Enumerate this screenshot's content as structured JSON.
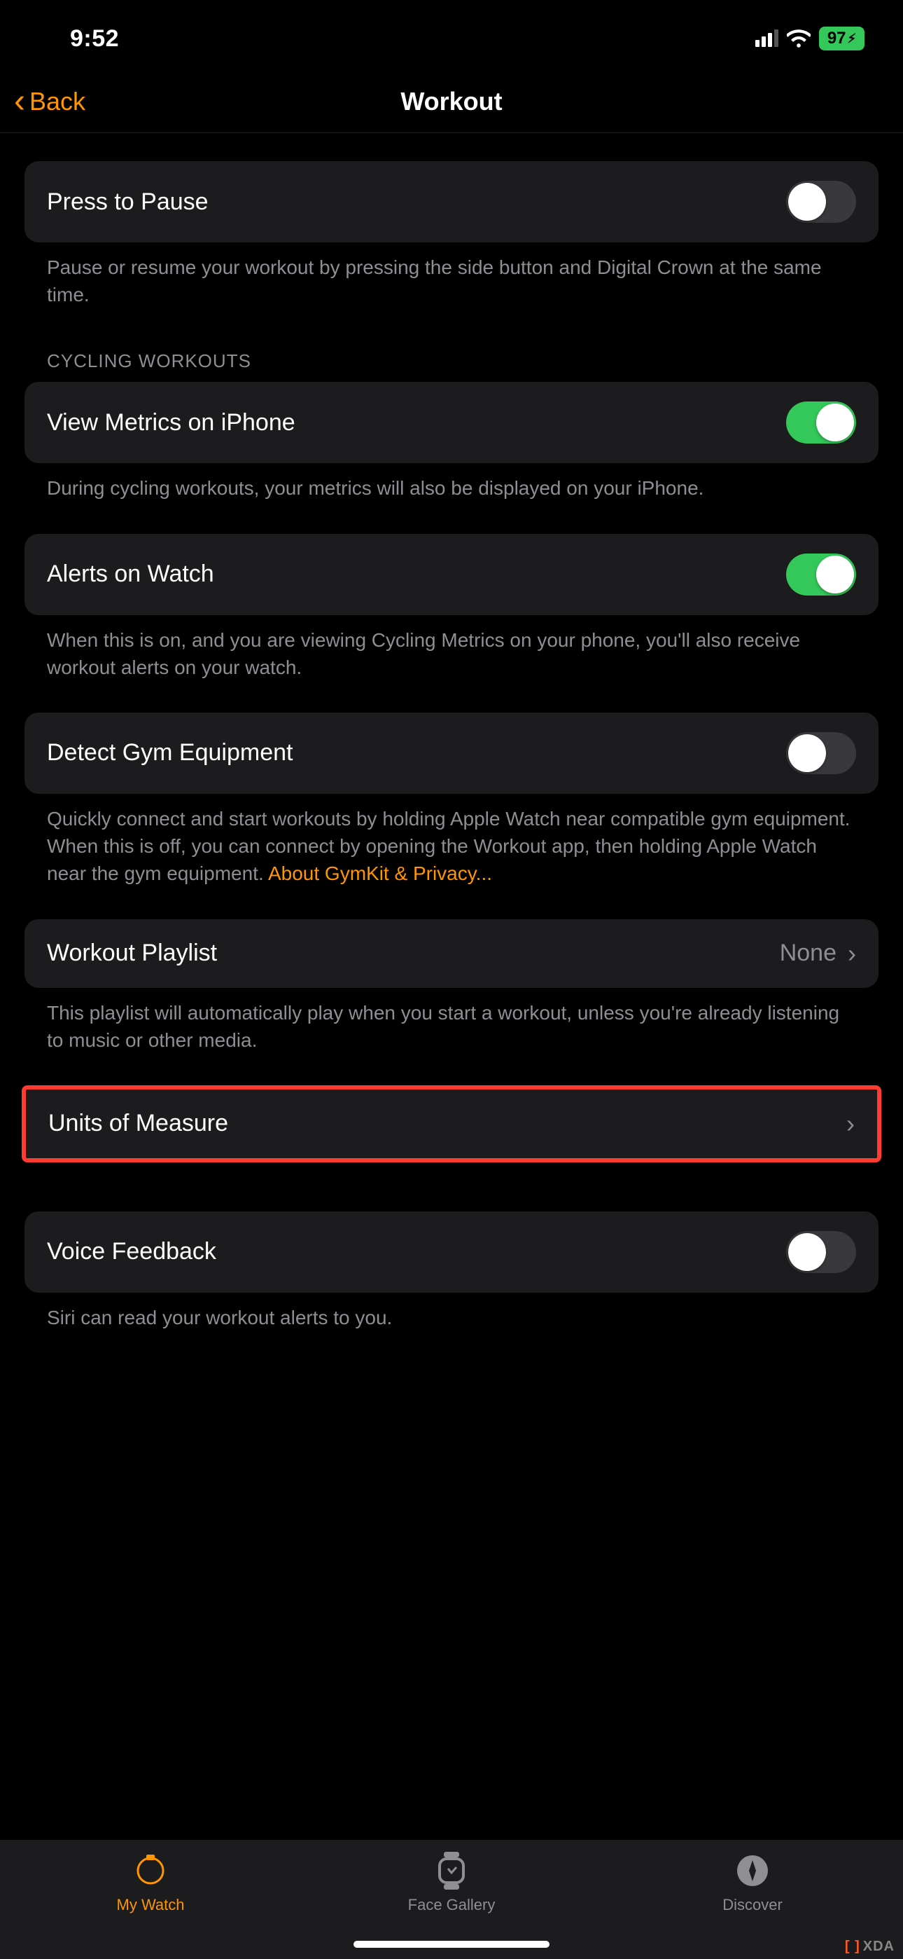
{
  "status": {
    "time": "9:52",
    "battery": "97"
  },
  "nav": {
    "back": "Back",
    "title": "Workout"
  },
  "rows": {
    "press_to_pause": {
      "label": "Press to Pause",
      "footer": "Pause or resume your workout by pressing the side button and Digital Crown at the same time."
    },
    "cycling_header": "CYCLING WORKOUTS",
    "view_metrics": {
      "label": "View Metrics on iPhone",
      "footer": "During cycling workouts, your metrics will also be displayed on your iPhone."
    },
    "alerts_on_watch": {
      "label": "Alerts on Watch",
      "footer": "When this is on, and you are viewing Cycling Metrics on your phone, you'll also receive workout alerts on your watch."
    },
    "detect_gym": {
      "label": "Detect Gym Equipment",
      "footer_main": "Quickly connect and start workouts by holding Apple Watch near compatible gym equipment. When this is off, you can connect by opening the Workout app, then holding Apple Watch near the gym equipment. ",
      "footer_link": "About GymKit & Privacy..."
    },
    "workout_playlist": {
      "label": "Workout Playlist",
      "value": "None",
      "footer": "This playlist will automatically play when you start a workout, unless you're already listening to music or other media."
    },
    "units_of_measure": {
      "label": "Units of Measure"
    },
    "voice_feedback": {
      "label": "Voice Feedback",
      "footer": "Siri can read your workout alerts to you."
    }
  },
  "tabs": {
    "my_watch": "My Watch",
    "face_gallery": "Face Gallery",
    "discover": "Discover"
  },
  "watermark": "XDA"
}
